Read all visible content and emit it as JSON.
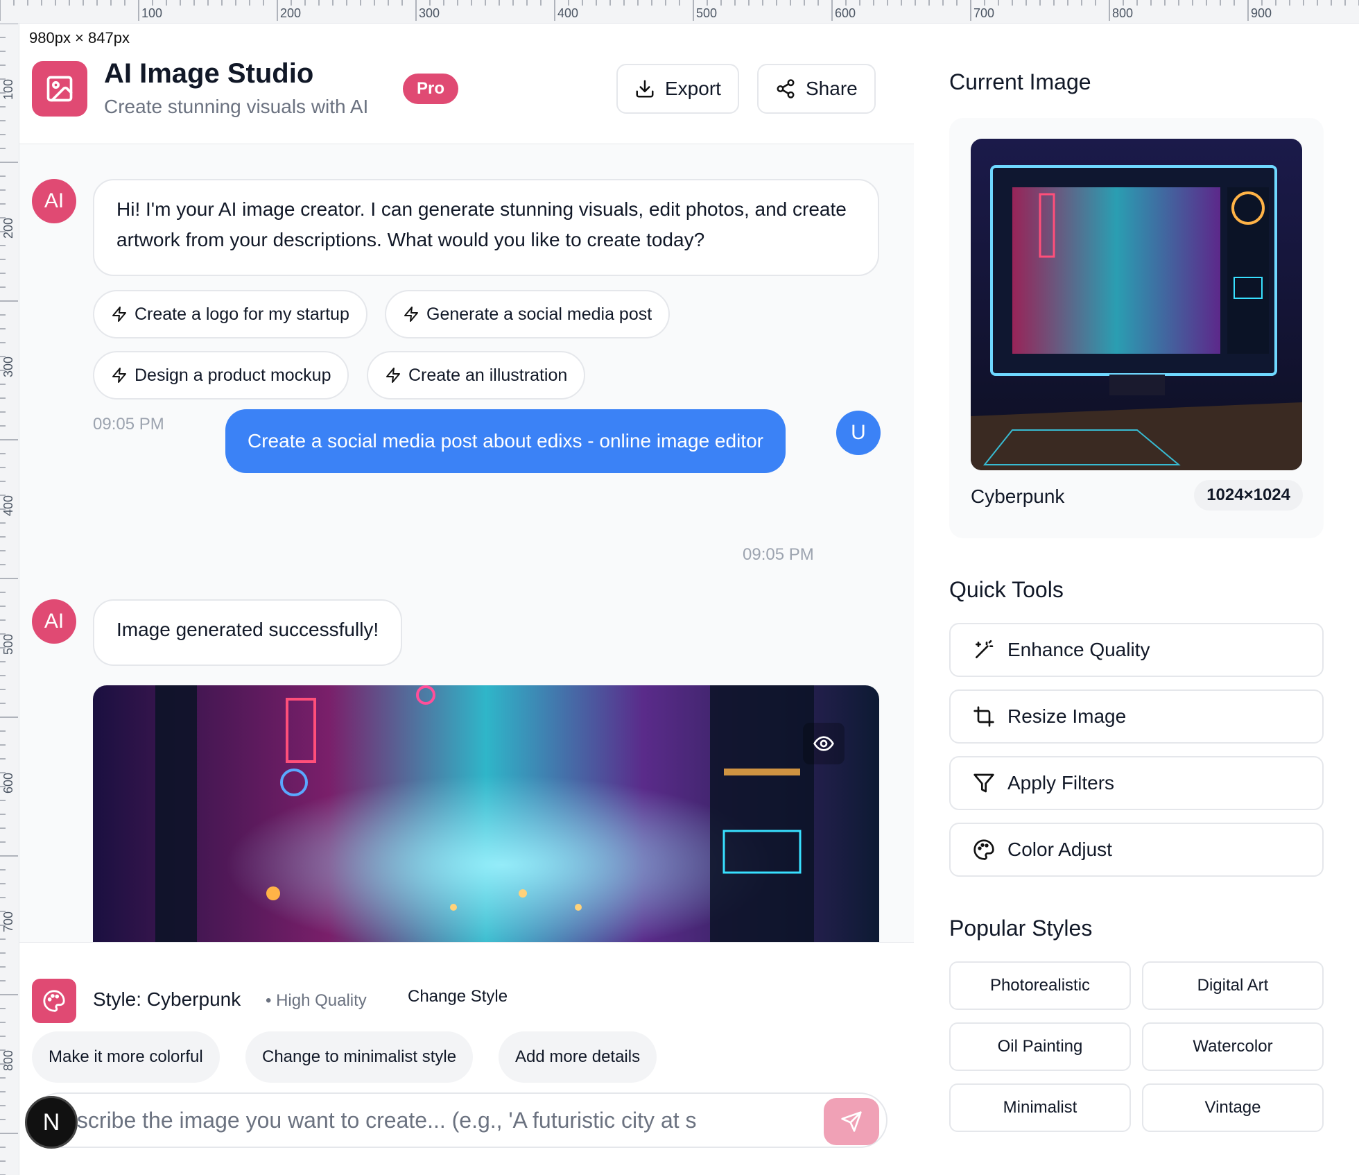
{
  "ruler": {
    "size_label": "980px × 847px",
    "h_labels": [
      "100",
      "200",
      "300",
      "400",
      "500",
      "600",
      "700",
      "800",
      "900"
    ],
    "v_labels": [
      "100",
      "200",
      "300",
      "400",
      "500",
      "600",
      "700",
      "800"
    ]
  },
  "header": {
    "title": "AI Image Studio",
    "subtitle": "Create stunning visuals with AI",
    "badge": "Pro",
    "export_label": "Export",
    "share_label": "Share"
  },
  "chat": {
    "ai_avatar": "AI",
    "user_avatar": "U",
    "greeting": "Hi! I'm your AI image creator. I can generate stunning visuals, edit photos, and create artwork from your descriptions. What would you like to create today?",
    "suggestions": [
      "Create a logo for my startup",
      "Generate a social media post",
      "Design a product mockup",
      "Create an illustration"
    ],
    "time1": "09:05 PM",
    "user_message": "Create a social media post about edixs - online image editor",
    "time2": "09:05 PM",
    "ai_result": "Image generated successfully!"
  },
  "bottom": {
    "style_label": "Style: Cyberpunk",
    "quality": "• High Quality",
    "change_style": "Change Style",
    "quick_prompts": [
      "Make it more colorful",
      "Change to minimalist style",
      "Add more details"
    ],
    "prompt_placeholder": "Describe the image you want to create... (e.g., 'A futuristic city at s"
  },
  "sidebar": {
    "current_heading": "Current Image",
    "current_name": "Cyberpunk",
    "current_res": "1024×1024",
    "tools_heading": "Quick Tools",
    "tools": [
      "Enhance Quality",
      "Resize Image",
      "Apply Filters",
      "Color Adjust"
    ],
    "styles_heading": "Popular Styles",
    "styles": [
      "Photorealistic",
      "Digital Art",
      "Oil Painting",
      "Watercolor",
      "Minimalist",
      "Vintage"
    ]
  },
  "floating": {
    "n_label": "N"
  },
  "colors": {
    "brand": "#e04a73",
    "user_bubble": "#3b82f6"
  }
}
